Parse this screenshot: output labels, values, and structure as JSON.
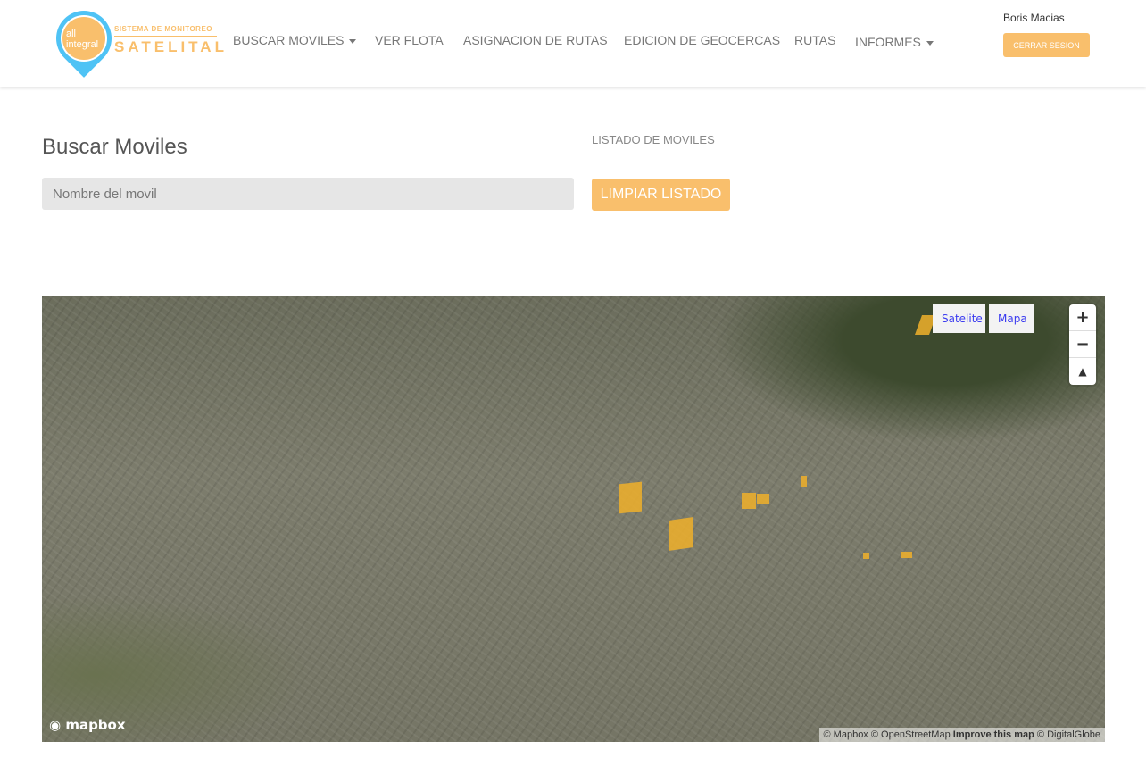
{
  "logo": {
    "brand": "all integral",
    "subtitle": "SISTEMA DE MONITOREO",
    "main": "SATELITAL"
  },
  "nav": [
    {
      "label": "BUSCAR MOVILES",
      "dropdown": true
    },
    {
      "label": "VER FLOTA"
    },
    {
      "label": "ASIGNACION DE RUTAS"
    },
    {
      "label": "EDICION DE GEOCERCAS"
    },
    {
      "label": "RUTAS"
    },
    {
      "label": "INFORMES",
      "dropdown": true
    }
  ],
  "user": {
    "name": "Boris Macias",
    "logout": "CERRAR SESION"
  },
  "search": {
    "title": "Buscar Moviles",
    "placeholder": "Nombre del movil"
  },
  "list": {
    "label": "LISTADO DE MOVILES",
    "clear": "LIMPIAR LISTADO"
  },
  "map": {
    "types": [
      "Satelite",
      "Mapa"
    ],
    "zoom_in": "+",
    "zoom_out": "−",
    "compass": "▲",
    "logo": "mapbox",
    "attribution": {
      "mapbox": "© Mapbox",
      "osm": "© OpenStreetMap",
      "improve": "Improve this map",
      "dg": "© DigitalGlobe"
    },
    "geofence_color": "#f0b02a"
  },
  "colors": {
    "accent": "#f9bf6c",
    "pin": "#4fc3f5"
  }
}
